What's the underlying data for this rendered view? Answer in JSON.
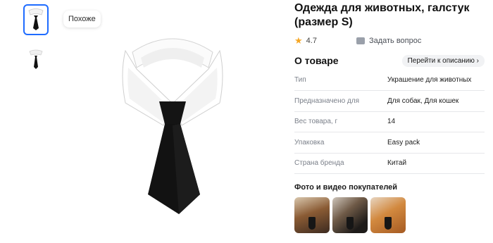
{
  "similar_label": "Похоже",
  "product": {
    "title": "Одежда для животных, галстук (размер S)",
    "rating": "4.7",
    "ask_label": "Задать вопрос"
  },
  "about": {
    "title": "О товаре",
    "goto_label": "Перейти к описанию",
    "goto_chevron": "›"
  },
  "specs": [
    {
      "key": "Тип",
      "value": "Украшение для животных"
    },
    {
      "key": "Предназначено для",
      "value": "Для собак, Для кошек"
    },
    {
      "key": "Вес товара, г",
      "value": "14"
    },
    {
      "key": "Упаковка",
      "value": "Easy pack"
    },
    {
      "key": "Страна бренда",
      "value": "Китай"
    }
  ],
  "photos_title": "Фото и видео покупателей",
  "colors": {
    "accent": "#1f6cff",
    "star": "#f5a623"
  }
}
